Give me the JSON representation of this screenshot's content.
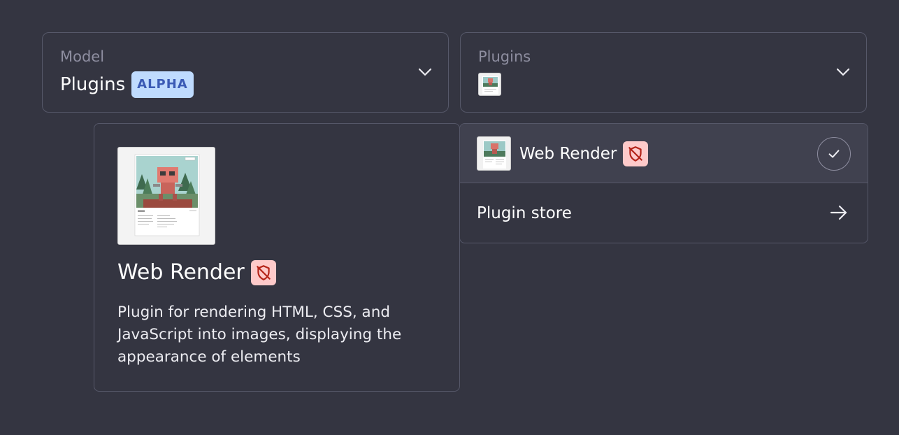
{
  "model_select": {
    "label": "Model",
    "value": "Plugins",
    "badge": "ALPHA"
  },
  "plugins_select": {
    "label": "Plugins",
    "selected_icon": "web-render-plugin-icon"
  },
  "plugin_detail": {
    "name": "Web Render",
    "description": "Plugin for rendering HTML, CSS, and JavaScript into images, displaying the appearance of elements",
    "status_icon": "shield-off-icon"
  },
  "plugin_menu": {
    "items": [
      {
        "label": "Web Render",
        "icon": "web-render-plugin-icon",
        "badge_icon": "shield-off-icon",
        "selected": true,
        "indicator_icon": "check-icon"
      }
    ],
    "store": {
      "label": "Plugin store",
      "icon": "arrow-right-icon"
    }
  },
  "colors": {
    "background": "#343541",
    "border": "#565869",
    "selected_row": "#40414f",
    "alpha_badge_bg": "#bfdbfe",
    "alpha_badge_text": "#3b5bb5",
    "shield_badge_bg": "#fecaca",
    "shield_icon": "#b42318"
  }
}
